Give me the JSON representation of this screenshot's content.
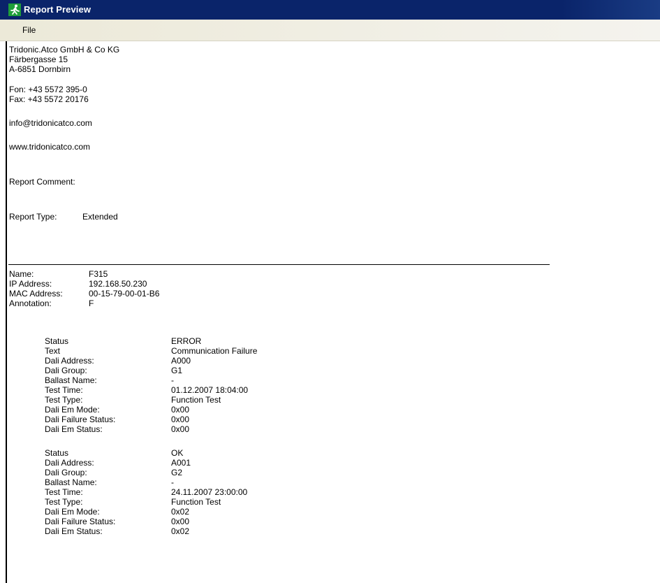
{
  "window": {
    "title": "Report Preview"
  },
  "menu": {
    "file": "File"
  },
  "company": {
    "name": "Tridonic.Atco GmbH & Co KG",
    "street": "Färbergasse 15",
    "city": "A-6851 Dornbirn",
    "phone": "Fon: +43 5572 395-0",
    "fax": "Fax: +43 5572 20176",
    "email": "info@tridonicatco.com",
    "web": "www.tridonicatco.com"
  },
  "report": {
    "comment_label": "Report Comment:",
    "type_label": "Report Type:",
    "type_value": "Extended"
  },
  "device": {
    "name_label": "Name:",
    "name_value": "F315",
    "ip_label": "IP Address:",
    "ip_value": "192.168.50.230",
    "mac_label": "MAC Address:",
    "mac_value": "00-15-79-00-01-B6",
    "annotation_label": "Annotation:",
    "annotation_value": "F"
  },
  "entries": [
    {
      "rows": [
        {
          "label": "Status",
          "value": "ERROR"
        },
        {
          "label": "Text",
          "value": "Communication Failure"
        },
        {
          "label": "Dali Address:",
          "value": "A000"
        },
        {
          "label": "Dali Group:",
          "value": "G1"
        },
        {
          "label": "Ballast Name:",
          "value": "-"
        },
        {
          "label": "Test Time:",
          "value": "01.12.2007 18:04:00"
        },
        {
          "label": "Test Type:",
          "value": "Function Test"
        },
        {
          "label": "Dali Em Mode:",
          "value": "0x00"
        },
        {
          "label": "Dali Failure Status:",
          "value": "0x00"
        },
        {
          "label": "Dali Em Status:",
          "value": "0x00"
        }
      ]
    },
    {
      "rows": [
        {
          "label": "Status",
          "value": "OK"
        },
        {
          "label": "Dali Address:",
          "value": "A001"
        },
        {
          "label": "Dali Group:",
          "value": "G2"
        },
        {
          "label": "Ballast Name:",
          "value": "-"
        },
        {
          "label": "Test Time:",
          "value": "24.11.2007 23:00:00"
        },
        {
          "label": "Test Type:",
          "value": "Function Test"
        },
        {
          "label": "Dali Em Mode:",
          "value": "0x02"
        },
        {
          "label": "Dali Failure Status:",
          "value": "0x00"
        },
        {
          "label": "Dali Em Status:",
          "value": "0x02"
        }
      ]
    }
  ]
}
